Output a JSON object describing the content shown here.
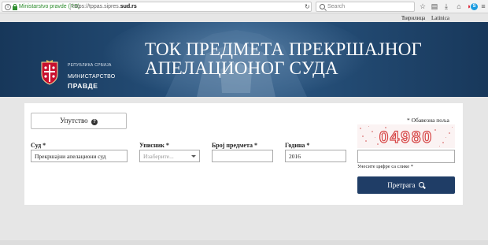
{
  "browser": {
    "identity": "Ministarstvo pravde (RS)",
    "url_prefix": "https://tppas.sipres.",
    "url_domain": "sud.rs",
    "search_placeholder": "Search",
    "toolbar_icons": [
      "bookmark-star-icon",
      "library-icon",
      "download-icon",
      "home-icon",
      "pocket-icon",
      "skype-icon",
      "menu-icon"
    ]
  },
  "language": {
    "cyrillic": "Ћирилица",
    "latin": "Latinica"
  },
  "banner": {
    "ministry_small": "РЕПУБЛИКА СРБИЈА",
    "ministry_main": "МИНИСТАРСТВО",
    "ministry_sub": "ПРАВДЕ",
    "title_line1": "ТОК ПРЕДМЕТА ПРЕКРШАЈНОГ",
    "title_line2": "АПЕЛАЦИОНОГ СУДА",
    "background_color": "#1c3d60"
  },
  "form": {
    "instructions_label": "Упутство",
    "required_note": "* Обавезна поља",
    "captcha_text": "04980",
    "fields": {
      "court_label": "Суд",
      "court_value": "Прекршајни апелациони суд",
      "registry_label": "Уписник",
      "registry_placeholder": "Изаберите...",
      "case_number_label": "Број предмета",
      "case_number_value": "",
      "year_label": "Година",
      "year_value": "2016"
    },
    "required_mark": "*",
    "captcha_label": "Унесите цифре са слике",
    "search_label": "Претрага",
    "accent_color": "#1f3d66"
  }
}
